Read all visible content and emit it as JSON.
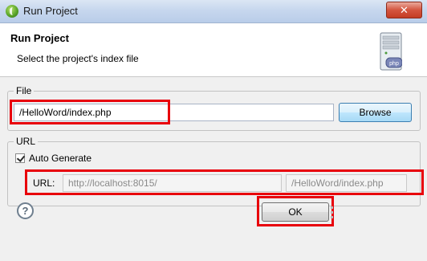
{
  "window": {
    "title": "Run Project",
    "close_glyph": "✕"
  },
  "header": {
    "title": "Run Project",
    "description": "Select the project's index file",
    "icon_badge": "php",
    "icon": "php-server-icon"
  },
  "file_group": {
    "label": "File",
    "path_value": "/HelloWord/index.php",
    "browse_label": "Browse"
  },
  "url_group": {
    "label": "URL",
    "auto_generate_label": "Auto Generate",
    "auto_generate_checked": true,
    "url_label": "URL:",
    "host_value": "http://localhost:8015/",
    "path_value": "/HelloWord/index.php"
  },
  "footer": {
    "help_glyph": "?",
    "ok_label": "OK"
  },
  "colors": {
    "highlight": "#e8000b"
  }
}
